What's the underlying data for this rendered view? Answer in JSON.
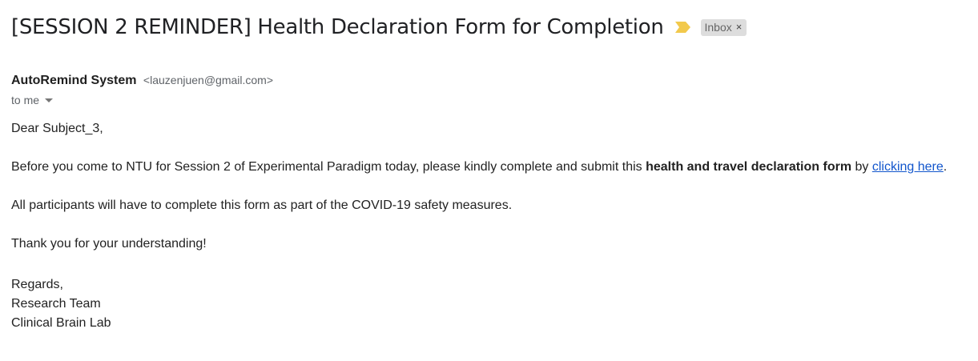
{
  "email": {
    "subject": "[SESSION 2 REMINDER] Health Declaration Form for Completion",
    "label": "Inbox",
    "label_close": "×",
    "importance_icon": "importance-marker-icon",
    "importance_color": "#f2c94c",
    "sender_name": "AutoRemind System",
    "sender_email": "<lauzenjuen@gmail.com>",
    "recipient": "to me",
    "body": {
      "greeting": "Dear Subject_3,",
      "para1_pre": "Before you come to NTU for Session 2 of Experimental Paradigm today, please kindly complete and submit this ",
      "para1_bold": "health and travel declaration form",
      "para1_mid": " by ",
      "para1_link": "clicking here",
      "para1_end": ".",
      "para2": "All participants will have to complete this form as part of the COVID-19 safety measures.",
      "para3": "Thank you for your understanding!",
      "signature": [
        "Regards,",
        "Research Team",
        "Clinical Brain Lab"
      ]
    }
  }
}
